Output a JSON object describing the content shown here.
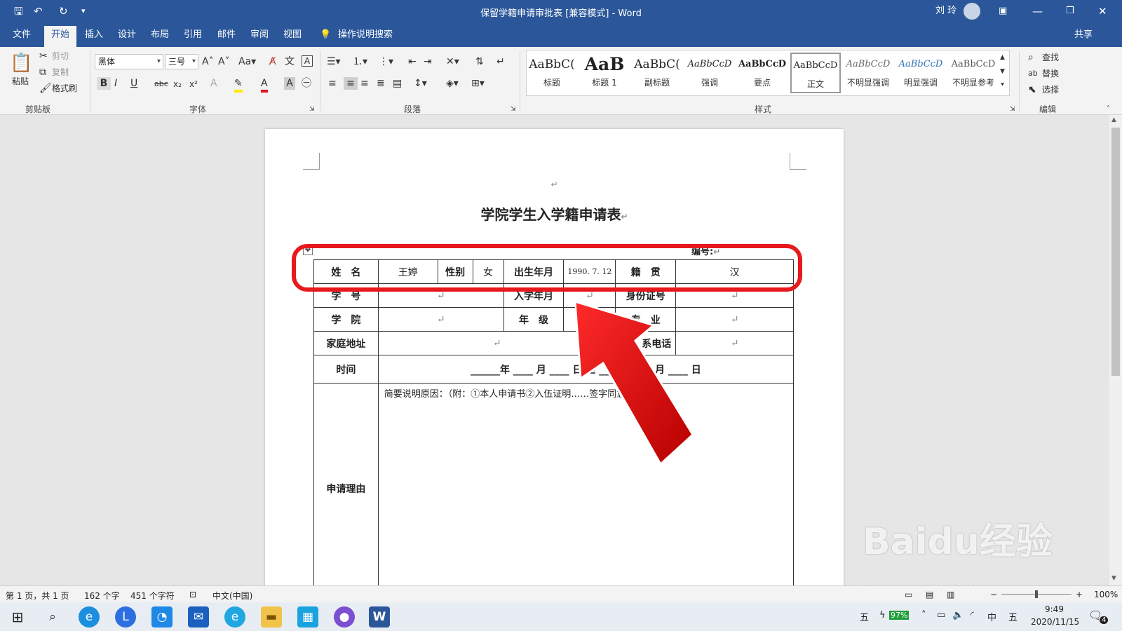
{
  "titlebar": {
    "title": "保留学籍申请审批表 [兼容模式] - Word",
    "user": "刘 玲"
  },
  "menu": {
    "tabs": [
      "文件",
      "开始",
      "插入",
      "设计",
      "布局",
      "引用",
      "邮件",
      "审阅",
      "视图"
    ],
    "tell_me": "操作说明搜索",
    "share": "共享"
  },
  "ribbon": {
    "clipboard": {
      "paste": "粘贴",
      "cut": "剪切",
      "copy": "复制",
      "format_painter": "格式刷",
      "label": "剪贴板"
    },
    "font": {
      "name": "黑体",
      "size": "三号",
      "label": "字体"
    },
    "paragraph": {
      "label": "段落"
    },
    "styles": {
      "label": "样式",
      "items": [
        {
          "sample": "AaBbC(",
          "name": "标题"
        },
        {
          "sample": "AaB",
          "name": "标题 1"
        },
        {
          "sample": "AaBbC(",
          "name": "副标题"
        },
        {
          "sample": "AaBbCcD",
          "name": "强调"
        },
        {
          "sample": "AaBbCcD",
          "name": "要点"
        },
        {
          "sample": "AaBbCcD",
          "name": "正文"
        },
        {
          "sample": "AaBbCcD",
          "name": "不明显强调"
        },
        {
          "sample": "AaBbCcD",
          "name": "明显强调"
        },
        {
          "sample": "AaBbCcD",
          "name": "不明显参考"
        }
      ]
    },
    "editing": {
      "find": "查找",
      "replace": "替换",
      "select": "选择",
      "label": "编辑"
    }
  },
  "document": {
    "title": "学院学生入学籍申请表",
    "serial_label": "编号:",
    "row1": {
      "name_label": "姓　名",
      "name_value": "王婷",
      "gender_label": "性别",
      "gender_value": "女",
      "birth_label": "出生年月",
      "birth_value": "1990. 7. 12",
      "origin_label": "籍　贯",
      "origin_value": "汉"
    },
    "row2": {
      "id_label": "学　号",
      "enroll_label": "入学年月",
      "idcard_label": "身份证号"
    },
    "row3": {
      "college_label": "学　院",
      "grade_label": "年　级",
      "major_label": "专　业"
    },
    "row4": {
      "address_label": "家庭地址",
      "phone_label": "系电话"
    },
    "row5": {
      "time_label": "时间",
      "time_value": "______年 ____ 月 ____ 日 至 ____ 年____ 月 ____ 日"
    },
    "row6": {
      "reason_label": "申请理由",
      "reason_text": "简要说明原因：（附：①本人申请书②入伍证明……签字同意书）"
    }
  },
  "status": {
    "page": "第 1 页，共 1 页",
    "words": "162 个字",
    "chars": "451 个字符",
    "lang": "中文(中国)",
    "zoom": "100%"
  },
  "taskbar": {
    "battery": "97%",
    "ime": "中",
    "ime2": "五",
    "time": "9:49",
    "date": "2020/11/15",
    "notif": "4"
  },
  "watermark": {
    "line1": "Baidu经验",
    "line2": "jingyan.baidu.com"
  }
}
